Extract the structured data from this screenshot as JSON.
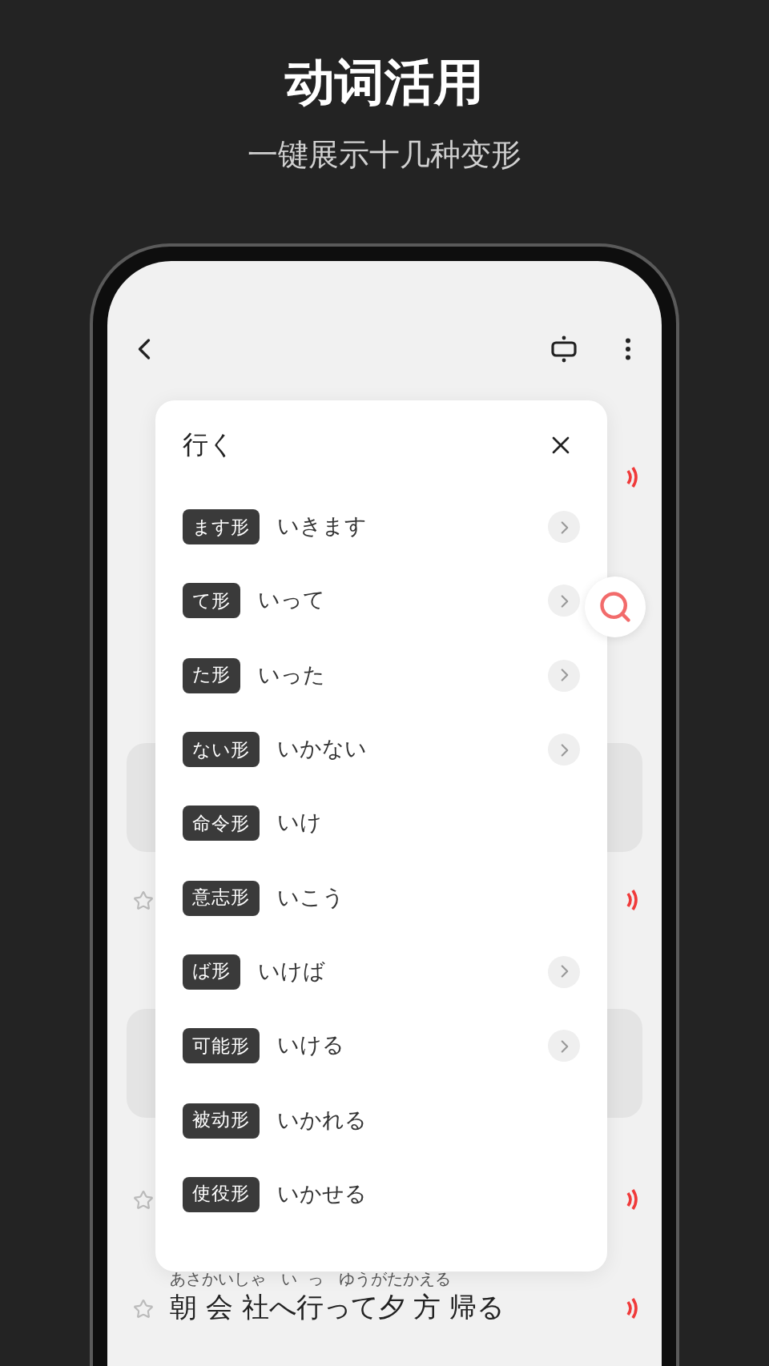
{
  "heading": "动词活用",
  "subheading": "一键展示十几种变形",
  "dialog": {
    "title": "行く",
    "forms": [
      {
        "tag": "ます形",
        "value": "いきます",
        "has_more": true
      },
      {
        "tag": "て形",
        "value": "いって",
        "has_more": true
      },
      {
        "tag": "た形",
        "value": "いった",
        "has_more": true
      },
      {
        "tag": "ない形",
        "value": "いかない",
        "has_more": true
      },
      {
        "tag": "命令形",
        "value": "いけ",
        "has_more": false
      },
      {
        "tag": "意志形",
        "value": "いこう",
        "has_more": false
      },
      {
        "tag": "ば形",
        "value": "いけば",
        "has_more": true
      },
      {
        "tag": "可能形",
        "value": "いける",
        "has_more": true
      },
      {
        "tag": "被动形",
        "value": "いかれる",
        "has_more": false
      },
      {
        "tag": "使役形",
        "value": "いかせる",
        "has_more": false
      }
    ]
  },
  "example": {
    "reading": "あさかいしゃ   い  っ   ゆうがたかえる",
    "sentence": "朝 会 社へ行って夕 方 帰る"
  }
}
